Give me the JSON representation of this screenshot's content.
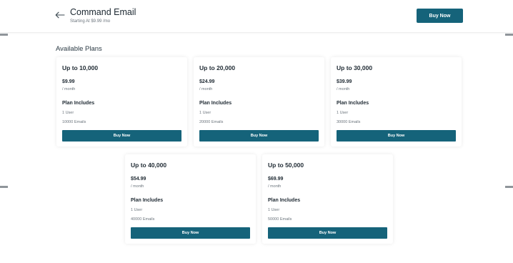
{
  "header": {
    "title": "Command Email",
    "subtitle": "Starting At $9.99 /mo",
    "buy_label": "Buy Now",
    "back_icon": "arrow-left-icon"
  },
  "section": {
    "title": "Available Plans"
  },
  "colors": {
    "accent": "#15637a",
    "text": "#1f2a33",
    "muted": "#6c757d"
  },
  "plans": [
    {
      "title": "Up to 10,000",
      "price": "$9.99",
      "period": "/ month",
      "includes_label": "Plan Includes",
      "users": "1 User",
      "emails": "10000 Emails",
      "buy_label": "Buy Now"
    },
    {
      "title": "Up to 20,000",
      "price": "$24.99",
      "period": "/ month",
      "includes_label": "Plan Includes",
      "users": "1 User",
      "emails": "20000 Emails",
      "buy_label": "Buy Now"
    },
    {
      "title": "Up to 30,000",
      "price": "$39.99",
      "period": "/ month",
      "includes_label": "Plan Includes",
      "users": "1 User",
      "emails": "30000 Emails",
      "buy_label": "Buy Now"
    },
    {
      "title": "Up to 40,000",
      "price": "$54.99",
      "period": "/ month",
      "includes_label": "Plan Includes",
      "users": "1 User",
      "emails": "40000 Emails",
      "buy_label": "Buy Now"
    },
    {
      "title": "Up to 50,000",
      "price": "$69.99",
      "period": "/ month",
      "includes_label": "Plan Includes",
      "users": "1 User",
      "emails": "50000 Emails",
      "buy_label": "Buy Now"
    }
  ]
}
